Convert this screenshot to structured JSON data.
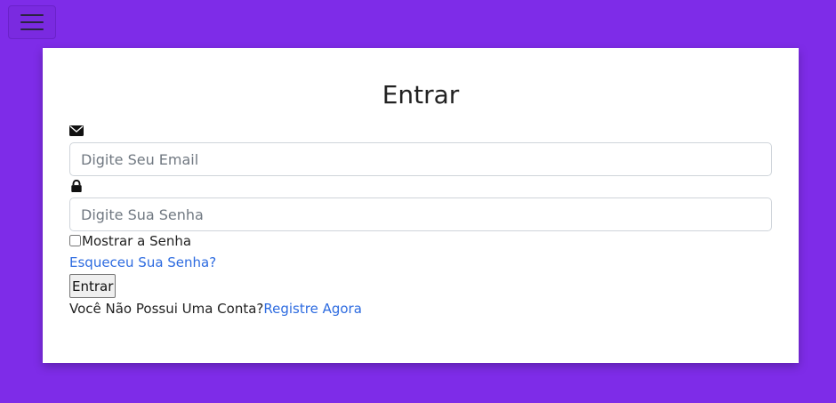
{
  "nav": {
    "menu_icon": "hamburger-icon"
  },
  "login": {
    "title": "Entrar",
    "email_icon": "envelope-icon",
    "email_placeholder": "Digite Seu Email",
    "password_icon": "lock-icon",
    "password_placeholder": "Digite Sua Senha",
    "show_password_label": "Mostrar a Senha",
    "forgot_password_link": "Esqueceu Sua Senha?",
    "submit_label": "Entrar",
    "no_account_text": "Você Não Possui Uma Conta?",
    "register_link": "Registre Agora"
  },
  "colors": {
    "background": "#7e2ce8",
    "link": "#2d6be0"
  }
}
